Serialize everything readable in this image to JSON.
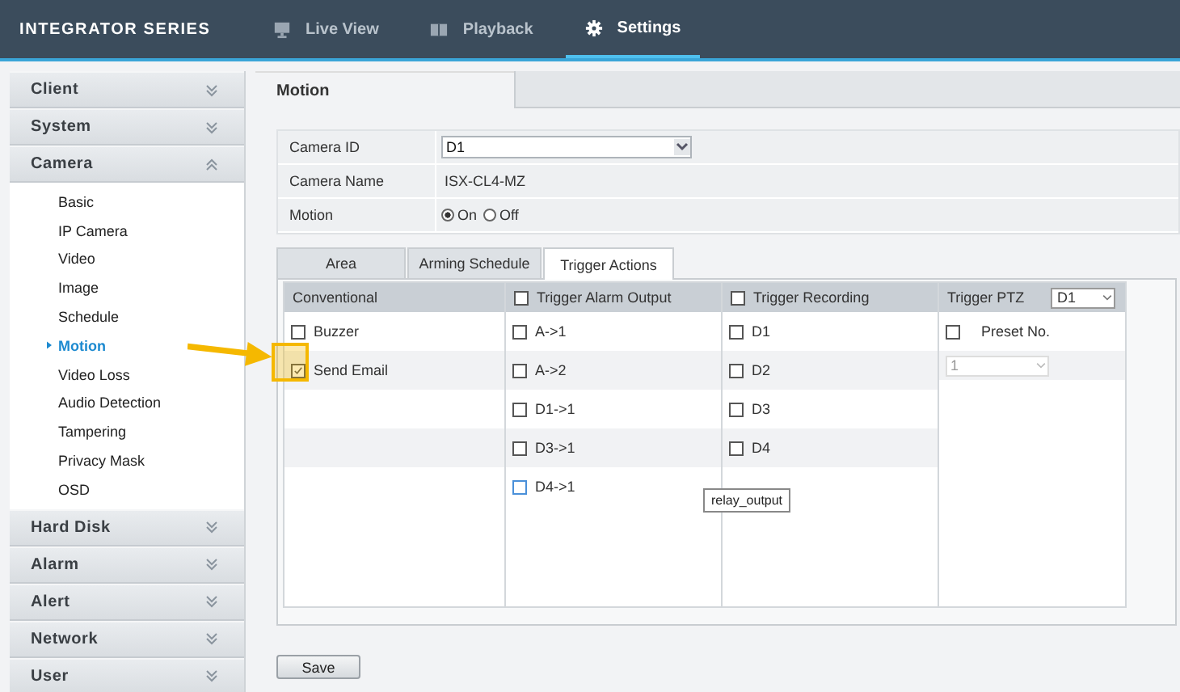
{
  "header": {
    "brand": "INTEGRATOR SERIES",
    "nav": [
      {
        "label": "Live View",
        "selected": false
      },
      {
        "label": "Playback",
        "selected": false
      },
      {
        "label": "Settings",
        "selected": true
      }
    ]
  },
  "sidebar": {
    "groups": [
      {
        "label": "Client",
        "expanded": false
      },
      {
        "label": "System",
        "expanded": false
      },
      {
        "label": "Camera",
        "expanded": true,
        "items": [
          {
            "label": "Basic",
            "selected": false
          },
          {
            "label": "IP Camera",
            "selected": false
          },
          {
            "label": "Video",
            "selected": false
          },
          {
            "label": "Image",
            "selected": false
          },
          {
            "label": "Schedule",
            "selected": false
          },
          {
            "label": "Motion",
            "selected": true
          },
          {
            "label": "Video Loss",
            "selected": false
          },
          {
            "label": "Audio Detection",
            "selected": false
          },
          {
            "label": "Tampering",
            "selected": false
          },
          {
            "label": "Privacy Mask",
            "selected": false
          },
          {
            "label": "OSD",
            "selected": false
          }
        ]
      },
      {
        "label": "Hard Disk",
        "expanded": false
      },
      {
        "label": "Alarm",
        "expanded": false
      },
      {
        "label": "Alert",
        "expanded": false
      },
      {
        "label": "Network",
        "expanded": false
      },
      {
        "label": "User",
        "expanded": false
      }
    ]
  },
  "page": {
    "title": "Motion",
    "form": [
      {
        "kind": "select",
        "label": "Camera ID",
        "value": "D1"
      },
      {
        "kind": "text",
        "label": "Camera Name",
        "value": "ISX-CL4-MZ"
      },
      {
        "kind": "radio",
        "label": "Motion",
        "options": [
          {
            "label": "On",
            "selected": true
          },
          {
            "label": "Off",
            "selected": false
          }
        ]
      }
    ],
    "tabs": [
      {
        "label": "Area",
        "selected": false
      },
      {
        "label": "Arming Schedule",
        "selected": false
      },
      {
        "label": "Trigger Actions",
        "selected": true
      }
    ],
    "columns": [
      {
        "kind": "list",
        "header": "Conventional",
        "items": [
          {
            "label": "Buzzer",
            "checked": false,
            "focused": false
          },
          {
            "label": "Send Email",
            "checked": true,
            "focused": false
          }
        ]
      },
      {
        "kind": "list",
        "header": "Trigger Alarm Output",
        "checked": false,
        "items": [
          {
            "label": "A->1",
            "checked": false,
            "focused": false
          },
          {
            "label": "A->2",
            "checked": false,
            "focused": false
          },
          {
            "label": "D1->1",
            "checked": false,
            "focused": false
          },
          {
            "label": "D3->1",
            "checked": false,
            "focused": false
          },
          {
            "label": "D4->1",
            "checked": false,
            "focused": true
          }
        ]
      },
      {
        "kind": "list",
        "header": "Trigger Recording",
        "checked": false,
        "items": [
          {
            "label": "D1",
            "checked": false,
            "focused": false
          },
          {
            "label": "D2",
            "checked": false,
            "focused": false
          },
          {
            "label": "D3",
            "checked": false,
            "focused": false
          },
          {
            "label": "D4",
            "checked": false,
            "focused": false
          }
        ]
      },
      {
        "kind": "ptz",
        "header": "Trigger PTZ",
        "camera": "D1",
        "preset_label": "Preset No.",
        "preset_checked": false,
        "preset_value": "1"
      }
    ],
    "tooltip": "relay_output",
    "save": "Save"
  }
}
